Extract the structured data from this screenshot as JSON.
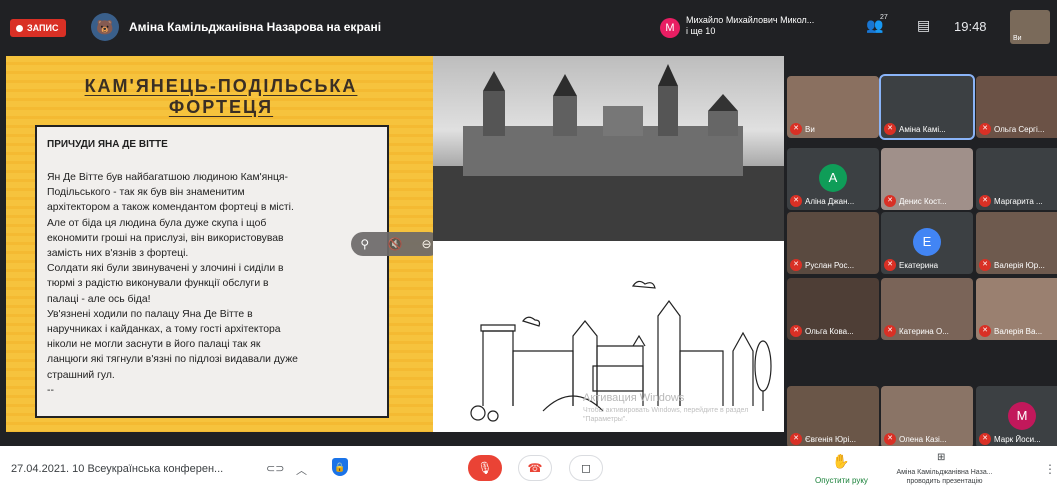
{
  "topbar": {
    "recording_label": "ЗАПИС",
    "presenting_text": "Аміна Камільджанівна Назарова на екрані",
    "speaker_initial": "М",
    "speaker_name": "Михайло Михайлович Микол...",
    "speaker_more": "і ще 10",
    "participant_count": "27",
    "clock": "19:48",
    "self_label": "Ви"
  },
  "slide": {
    "title_line1": "КАМ'ЯНЕЦЬ-ПОДІЛЬСЬКА",
    "title_line2": "ФОРТЕЦЯ",
    "box_heading": "ПРИЧУДИ ЯНА ДЕ ВІТТЕ",
    "box_body": "Ян Де Вітте  був найбагатшою людиною Кам'янця-\nПодільського - так як був він знаменитим\nархітектором а також комендантом фортеці в місті.\nАле от біда ця людина була дуже скупа і щоб\nекономити гроші на прислузі, він використовував\nзамість них в'язнів з фортеці.\nСолдати які були звинувачені у злочині і сиділи в\nтюрмі з радістю виконували функції обслуги в\nпалаці - але ось біда!\nУв'язнені ходили по палацу  Яна Де Вітте  в\nнаручниках і кайданках, а тому гості архітектора\nніколи не могли заснути в його палаці так як\nланцюги які тягнули в'язні по підлозі видавали дуже\nстрашний гул.\n--",
    "watermark_title": "Активация Windows",
    "watermark_sub": "Чтобы активировать Windows, перейдите в раздел \"Параметры\"."
  },
  "tiles": [
    {
      "name": "Ви",
      "initial": "",
      "bg": "#8a7060"
    },
    {
      "name": "Аміна Камі...",
      "initial": "",
      "bg": "#3c4043",
      "active": true
    },
    {
      "name": "Ольга Сергі...",
      "initial": "",
      "bg": "#6b5246"
    },
    {
      "name": "Аліна Джан...",
      "initial": "A",
      "bg": "#3c4043",
      "avatar_color": "#0f9d58"
    },
    {
      "name": "Денис Кост...",
      "initial": "",
      "bg": "#a0908a"
    },
    {
      "name": "Маргарита ...",
      "initial": "",
      "bg": "#3c4043"
    },
    {
      "name": "Руслан Рос...",
      "initial": "",
      "bg": "#5a4a40"
    },
    {
      "name": "Екатерина",
      "initial": "E",
      "bg": "#3c4043",
      "avatar_color": "#4285f4"
    },
    {
      "name": "Валерія Юр...",
      "initial": "",
      "bg": "#6e5a4e"
    },
    {
      "name": "Ольга Кова...",
      "initial": "",
      "bg": "#4e3e36"
    },
    {
      "name": "Катерина О...",
      "initial": "",
      "bg": "#7a6458"
    },
    {
      "name": "Валерія Ва...",
      "initial": "",
      "bg": "#9a8070"
    },
    {
      "name": "Євгенія Юрі...",
      "initial": "",
      "bg": "#6a5648"
    },
    {
      "name": "Олена Казі...",
      "initial": "",
      "bg": "#8a7466"
    },
    {
      "name": "Марк Йоси...",
      "initial": "M",
      "bg": "#3c4043",
      "avatar_color": "#c2185b"
    }
  ],
  "bottom": {
    "meeting_title": "27.04.2021. 10 Всеукраїнська конферен...",
    "lower_hand": "Опустити руку",
    "presenter_line1": "Аміна Камільджанівна Наза...",
    "presenter_line2": "проводить презентацію"
  }
}
